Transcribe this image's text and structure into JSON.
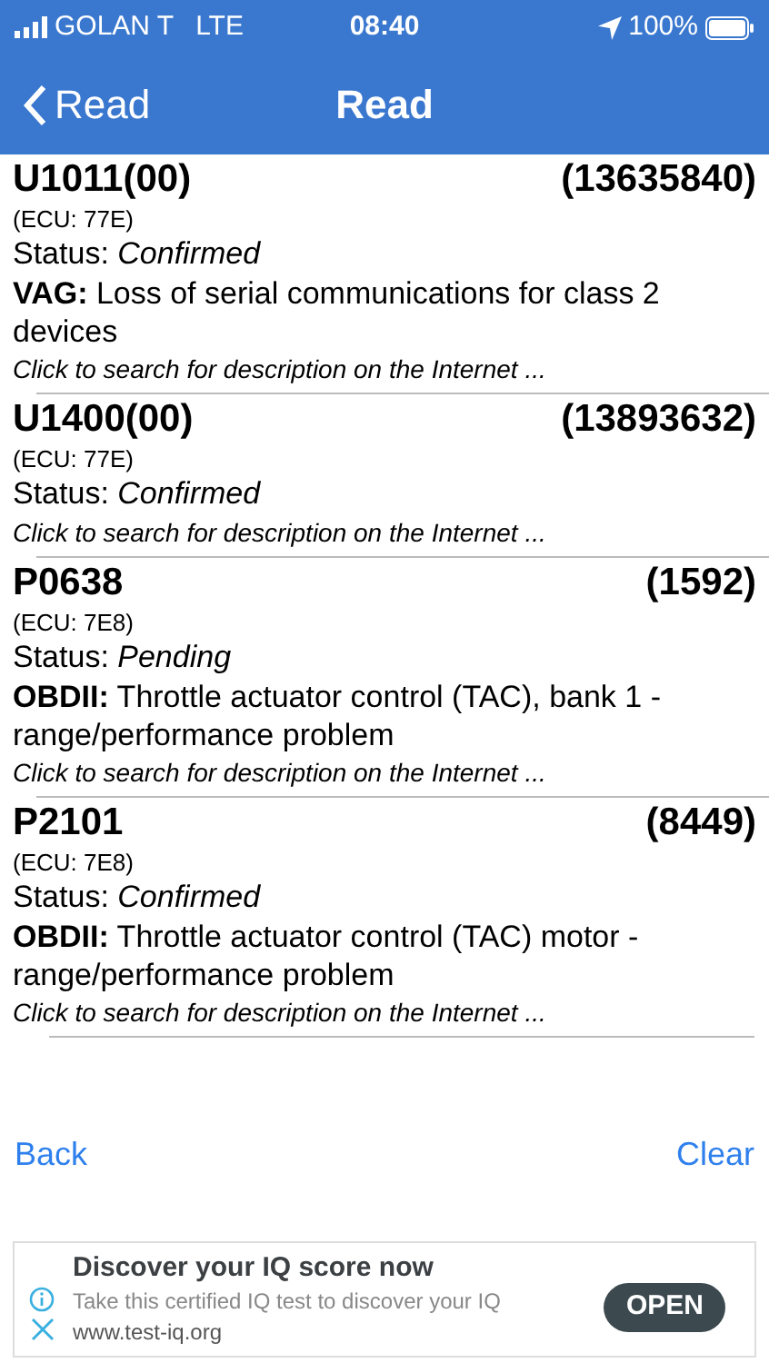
{
  "status_bar": {
    "carrier": "GOLAN T",
    "network": "LTE",
    "time": "08:40",
    "battery": "100%"
  },
  "nav": {
    "back": "Read",
    "title": "Read"
  },
  "codes": [
    {
      "code": "U1011(00)",
      "count": "(13635840)",
      "ecu": "(ECU: 77E)",
      "status": "Status: *Confirmed*",
      "description": "**VAG:** Loss of serial communications for class 2 devices",
      "link": "Click to search for description on the Internet ..."
    },
    {
      "code": "U1400(00)",
      "count": "(13893632)",
      "ecu": "(ECU: 77E)",
      "status": "Status: *Confirmed*",
      "link": "Click to search for description on the Internet ..."
    },
    {
      "code": "P0638",
      "count": "(1592)",
      "ecu": "(ECU: 7E8)",
      "status": "Status: *Pending*",
      "description": "**OBDII:** Throttle actuator control (TAC), bank 1 - range/performance problem",
      "link": "Click to search for description on the Internet ..."
    },
    {
      "code": "P2101",
      "count": "(8449)",
      "ecu": "(ECU: 7E8)",
      "status": "Status: *Confirmed*",
      "description": "**OBDII:** Throttle actuator control (TAC) motor - range/performance problem",
      "link": "Click to search for description on the Internet ..."
    }
  ],
  "actions": {
    "back": "Back",
    "clear": "Clear"
  },
  "ad": {
    "title": "Discover your IQ score now",
    "text": "Take this certified IQ test to discover your IQ",
    "url": "www.test-iq.org",
    "button": "OPEN"
  }
}
